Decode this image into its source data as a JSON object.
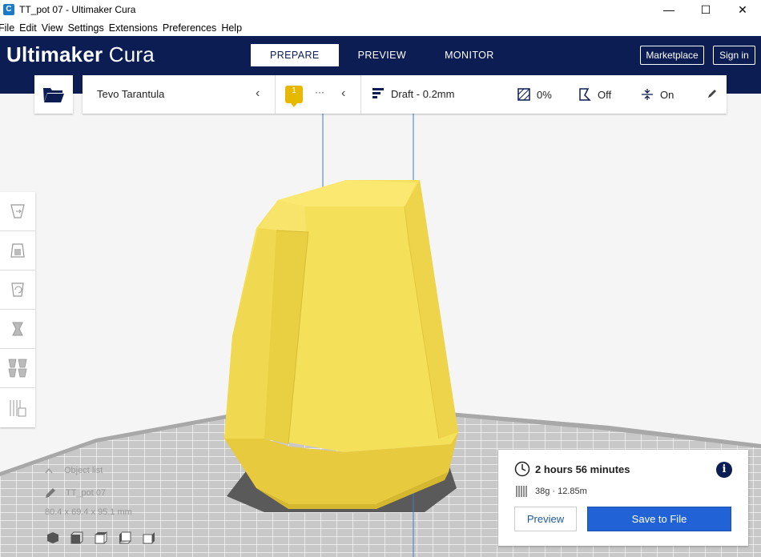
{
  "window": {
    "title": "TT_pot 07 - Ultimaker Cura",
    "app_icon_letter": "C",
    "minimize": "—",
    "maximize": "☐",
    "close": "✕"
  },
  "menu": [
    "File",
    "Edit",
    "View",
    "Settings",
    "Extensions",
    "Preferences",
    "Help"
  ],
  "header": {
    "brand_bold": "Ultimaker",
    "brand_light": "Cura",
    "tabs": [
      {
        "label": "PREPARE",
        "active": true
      },
      {
        "label": "PREVIEW",
        "active": false
      },
      {
        "label": "MONITOR",
        "active": false
      }
    ],
    "marketplace_label": "Marketplace",
    "signin_label": "Sign in",
    "bg_color": "#0b1d53"
  },
  "toolbar": {
    "printer_name": "Tevo Tarantula",
    "material_count": "1",
    "material_more": "···",
    "profile": "Draft - 0.2mm",
    "infill": "0%",
    "support": "Off",
    "adhesion": "On"
  },
  "left_tools": [
    "move-tool",
    "scale-tool",
    "rotate-tool",
    "mirror-tool",
    "per-model-settings-tool",
    "support-blocker-tool"
  ],
  "object_list": {
    "label": "Object list",
    "object_name": "TT_pot 07",
    "dimensions": "80.4 x 69.4 x 95.1 mm"
  },
  "print_info": {
    "time": "2 hours 56 minutes",
    "material": "38g · 12.85m",
    "info_glyph": "i",
    "preview_label": "Preview",
    "save_label": "Save to File"
  },
  "colors": {
    "model": "#f5e05a",
    "accent": "#2163d7",
    "material_badge": "#e6b800"
  }
}
